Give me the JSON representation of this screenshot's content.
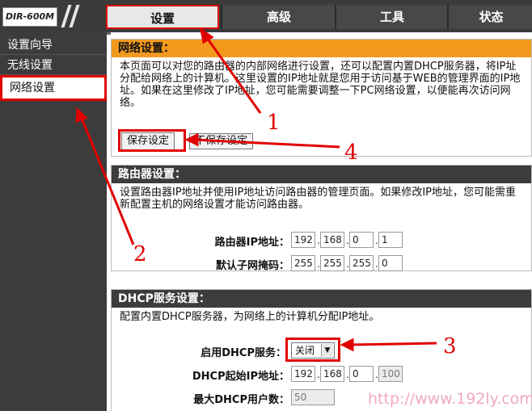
{
  "brand": {
    "model": "DIR-600M"
  },
  "tabs": [
    {
      "label": "设置"
    },
    {
      "label": "高级"
    },
    {
      "label": "工具"
    },
    {
      "label": "状态"
    }
  ],
  "sidebar": {
    "items": [
      {
        "label": "设置向导"
      },
      {
        "label": "无线设置"
      },
      {
        "label": "网络设置"
      }
    ]
  },
  "network": {
    "title": "网络设置：",
    "description": "本页面可以对您的路由器的内部网络进行设置，还可以配置内置DHCP服务器，将IP址分配给网络上的计算机。这里设置的IP地址就是您用于访问基于WEB的管理界面的IP地址。如果在这里修改了IP地址，您可能需要调整一下PC网络设置，以便能再次访问网络。",
    "save_label": "保存设定",
    "nosave_label": "不保存设定"
  },
  "router": {
    "title": "路由器设置：",
    "description": "设置路由器IP地址并使用IP地址访问路由器的管理页面。如果修改IP地址，您可能需重新配置主机的网络设置才能访问路由器。",
    "ip_label": "路由器IP地址：",
    "ip": [
      "192",
      "168",
      "0",
      "1"
    ],
    "mask_label": "默认子网掩码：",
    "mask": [
      "255",
      "255",
      "255",
      "0"
    ]
  },
  "dhcp": {
    "title": "DHCP服务设置：",
    "description": "配置内置DHCP服务器，为网络上的计算机分配IP地址。",
    "enable_label": "启用DHCP服务：",
    "enable_value": "关闭",
    "start_label": "DHCP起始IP地址：",
    "start_ip": [
      "192",
      "168",
      "0",
      "100"
    ],
    "max_label": "最大DHCP用户数：",
    "max_value": "50"
  },
  "annotations": [
    "1",
    "2",
    "3",
    "4"
  ],
  "watermark": "http://www.192ly.com",
  "colors": {
    "highlight": "#e00000",
    "header_orange": "#f39a1e",
    "dark": "#3c3c3c"
  }
}
